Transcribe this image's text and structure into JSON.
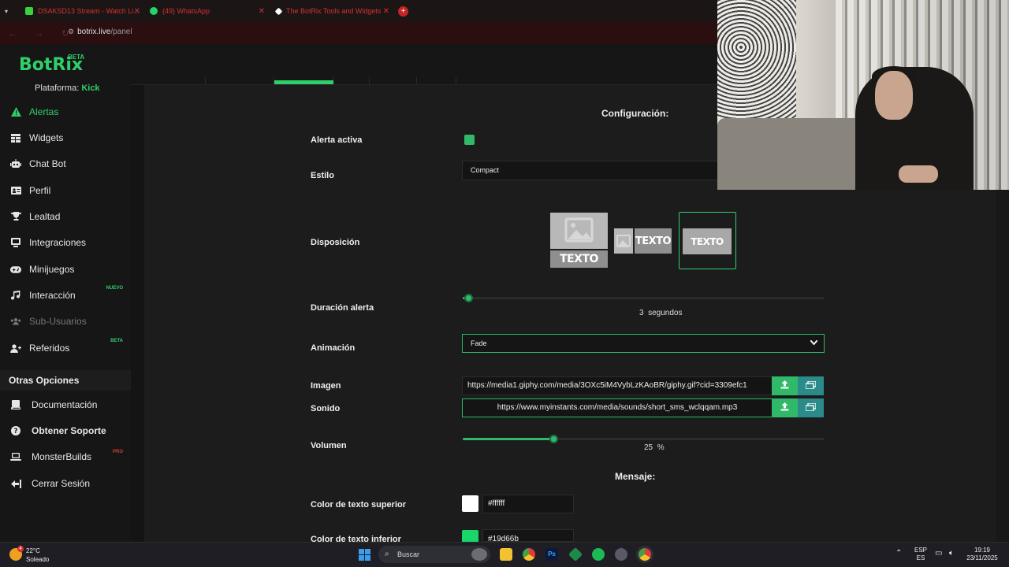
{
  "browser": {
    "tabs": [
      {
        "title": "DSAKSD13 Stream - Watch Li...",
        "color": "#3ad23a"
      },
      {
        "title": "(49) WhatsApp",
        "color": "#25d366"
      },
      {
        "title": "The BotRix Tools and Widgets",
        "color": "#ffffff"
      }
    ],
    "url_host": "botrix.live",
    "url_path": "/panel"
  },
  "app": {
    "logo": "BotRix",
    "logo_badge": "BETA",
    "platform_label": "Plataforma:",
    "platform_value": "Kick"
  },
  "sidebar": {
    "items": [
      {
        "label": "Alertas",
        "icon": "warning-icon",
        "active": true
      },
      {
        "label": "Widgets",
        "icon": "grid-icon"
      },
      {
        "label": "Chat Bot",
        "icon": "robot-icon"
      },
      {
        "label": "Perfil",
        "icon": "id-card-icon"
      },
      {
        "label": "Lealtad",
        "icon": "trophy-icon"
      },
      {
        "label": "Integraciones",
        "icon": "plug-icon"
      },
      {
        "label": "Minijuegos",
        "icon": "gamepad-icon"
      },
      {
        "label": "Interacción",
        "icon": "music-icon",
        "badge": "NUEVO"
      },
      {
        "label": "Sub-Usuarios",
        "icon": "users-icon",
        "dim": true
      },
      {
        "label": "Referidos",
        "icon": "user-plus-icon",
        "badge": "BETA"
      }
    ],
    "other_heading": "Otras Opciones",
    "other": [
      {
        "label": "Documentación",
        "icon": "book-icon"
      },
      {
        "label": "Obtener Soporte",
        "icon": "help-icon"
      },
      {
        "label": "MonsterBuilds",
        "icon": "laptop-icon",
        "badge": "PRO"
      },
      {
        "label": "Cerrar Sesión",
        "icon": "logout-icon"
      }
    ]
  },
  "config": {
    "title": "Configuración:",
    "active_label": "Alerta activa",
    "active": true,
    "style_label": "Estilo",
    "style_value": "Compact",
    "layout_label": "Disposición",
    "layout_text": "TEXTO",
    "duration_label": "Duración alerta",
    "duration_value": "3",
    "duration_unit": "segundos",
    "duration_fraction": 0.015,
    "animation_label": "Animación",
    "animation_value": "Fade",
    "image_label": "Imagen",
    "image_url": "https://media1.giphy.com/media/3OXc5iM4VybLzKAoBR/giphy.gif?cid=3309efc1",
    "sound_label": "Sonido",
    "sound_url": "https://www.myinstants.com/media/sounds/short_sms_wclqqam.mp3",
    "volume_label": "Volumen",
    "volume_value": "25",
    "volume_unit": "%",
    "volume_fraction": 0.25
  },
  "message": {
    "title": "Mensaje:",
    "top_color_label": "Color de texto superior",
    "top_color": "#ffffff",
    "bottom_color_label": "Color de texto inferior",
    "bottom_color": "#19d66b"
  },
  "taskbar": {
    "temp": "22°C",
    "weather": "Soleado",
    "weather_badge": "4",
    "search_placeholder": "Buscar",
    "lang_top": "ESP",
    "lang_bottom": "ES",
    "time": "19:19",
    "date": "23/11/2025"
  }
}
